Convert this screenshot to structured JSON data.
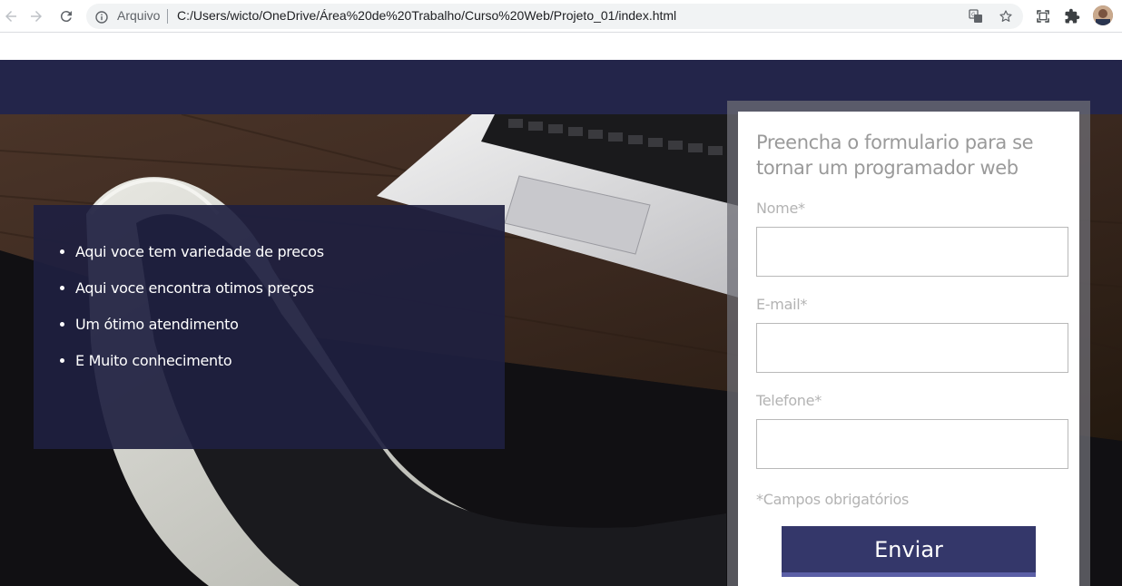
{
  "browser": {
    "scheme_label": "Arquivo",
    "url": "C:/Users/wicto/OneDrive/Área%20de%20Trabalho/Curso%20Web/Projeto_01/index.html",
    "icons": [
      "back-icon",
      "forward-icon",
      "reload-icon",
      "info-icon",
      "translate-icon",
      "star-icon",
      "screen-capture-icon",
      "extensions-icon",
      "profile-avatar"
    ]
  },
  "features": {
    "items": [
      "Aqui voce tem variedade de precos",
      "Aqui voce encontra otimos preços",
      "Um ótimo atendimento",
      "E Muito conhecimento"
    ]
  },
  "form": {
    "title": "Preencha o formulario para se tornar um programador web",
    "name_label": "Nome*",
    "email_label": "E-mail*",
    "phone_label": "Telefone*",
    "name_value": "",
    "email_value": "",
    "phone_value": "",
    "required_note": "*Campos obrigatórios",
    "submit_label": "Enviar"
  },
  "colors": {
    "header": "#23254a",
    "panel": "#1e1f40",
    "button": "#34376a"
  }
}
